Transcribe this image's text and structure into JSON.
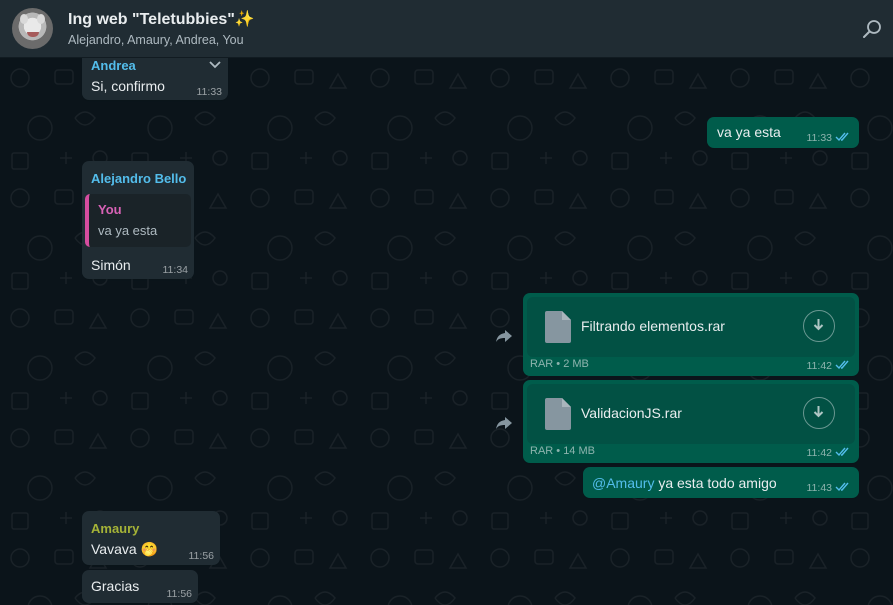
{
  "header": {
    "title": "Ing web \"Teletubbies\"✨",
    "subtitle": "Alejandro, Amaury, Andrea, You",
    "avatar_icon": "group-avatar",
    "search_icon": "search-icon"
  },
  "colors": {
    "incoming_bubble": "#202c33",
    "outgoing_bubble": "#005c4b",
    "andrea": "#53bdeb",
    "alejandro": "#53bdeb",
    "amaury": "#a5b337",
    "you_quote": "#d862b6",
    "mention": "#53bdeb",
    "read_ticks": "#53bdeb"
  },
  "messages": {
    "m1": {
      "sender": "Andrea",
      "text": "Si, confirmo",
      "time": "11:33"
    },
    "m2": {
      "text": "va ya esta",
      "time": "11:33"
    },
    "m3": {
      "sender": "Alejandro Bello",
      "quote_sender": "You",
      "quote_text": "va ya esta",
      "text": "Simón",
      "time": "11:34"
    },
    "m4": {
      "file_name": "Filtrando elementos.rar",
      "meta": "RAR • 2 MB",
      "time": "11:42"
    },
    "m5": {
      "file_name": "ValidacionJS.rar",
      "meta": "RAR • 14 MB",
      "time": "11:42"
    },
    "m6": {
      "mention": "@Amaury",
      "text": " ya esta todo amigo",
      "time": "11:43"
    },
    "m7": {
      "sender": "Amaury",
      "text": "Vavava 🤭",
      "time": "11:56"
    },
    "m8": {
      "text": "Gracias",
      "time": "11:56"
    }
  }
}
